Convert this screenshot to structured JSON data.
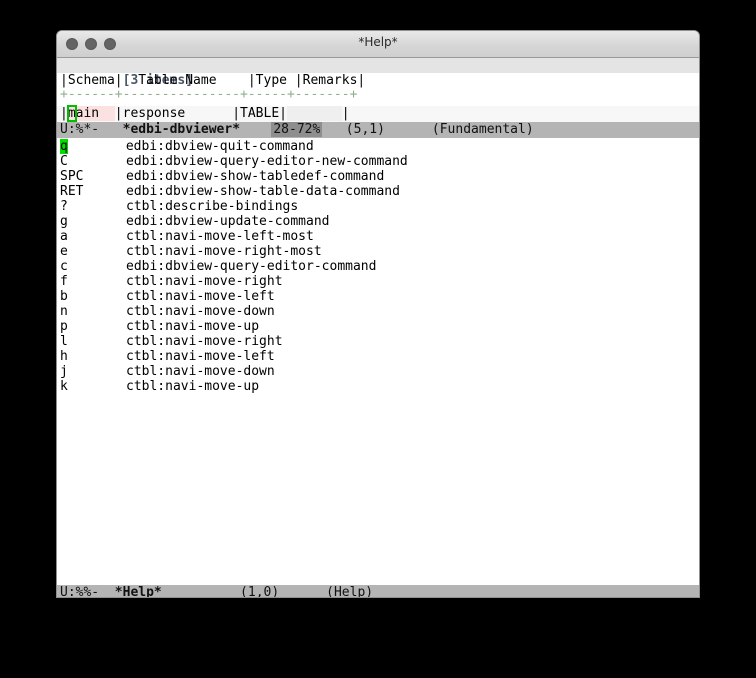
{
  "window": {
    "title": "*Help*",
    "traffic_lights": [
      "close",
      "minimize",
      "zoom"
    ]
  },
  "dbviewer": {
    "items_count": "[3 items]",
    "column_header": "|Schema|  Table Name    |Type |Remarks|",
    "separator": "+------+---------------+-----+-------+",
    "columns": [
      "Schema",
      "Table Name",
      "Type",
      "Remarks"
    ],
    "rows": [
      {
        "schema": "main",
        "table_name": "response",
        "type": "TABLE",
        "remarks": ""
      }
    ],
    "cursor_char": "m",
    "modeline": {
      "flags": "U:%*-",
      "buffer": "*edbi-dbviewer*",
      "percent": "28-72%",
      "position": "(5,1)",
      "mode": "(Fundamental)"
    }
  },
  "help": {
    "cursor_key": "q",
    "bindings": [
      {
        "key": "q",
        "command": "edbi:dbview-quit-command"
      },
      {
        "key": "C",
        "command": "edbi:dbview-query-editor-new-command"
      },
      {
        "key": "SPC",
        "command": "edbi:dbview-show-tabledef-command"
      },
      {
        "key": "RET",
        "command": "edbi:dbview-show-table-data-command"
      },
      {
        "key": "?",
        "command": "ctbl:describe-bindings"
      },
      {
        "key": "g",
        "command": "edbi:dbview-update-command"
      },
      {
        "key": "a",
        "command": "ctbl:navi-move-left-most"
      },
      {
        "key": "e",
        "command": "ctbl:navi-move-right-most"
      },
      {
        "key": "c",
        "command": "edbi:dbview-query-editor-command"
      },
      {
        "key": "f",
        "command": "ctbl:navi-move-right"
      },
      {
        "key": "b",
        "command": "ctbl:navi-move-left"
      },
      {
        "key": "n",
        "command": "ctbl:navi-move-down"
      },
      {
        "key": "p",
        "command": "ctbl:navi-move-up"
      },
      {
        "key": "l",
        "command": "ctbl:navi-move-right"
      },
      {
        "key": "h",
        "command": "ctbl:navi-move-left"
      },
      {
        "key": "j",
        "command": "ctbl:navi-move-down"
      },
      {
        "key": "k",
        "command": "ctbl:navi-move-up"
      }
    ],
    "modeline": {
      "flags": "U:%%-",
      "buffer": "*Help*",
      "position": "(1,0)",
      "mode": "(Help)"
    }
  },
  "colors": {
    "cursor_green": "#00dd00",
    "schema_highlight": "#fbe2e0",
    "modeline_bg": "#b4b4b4",
    "modeline_percent_bg": "#8e8e8e",
    "header_band_bg": "#e4e4e4",
    "separator_green": "#8fae8f",
    "items_count_color": "#4a5568"
  }
}
